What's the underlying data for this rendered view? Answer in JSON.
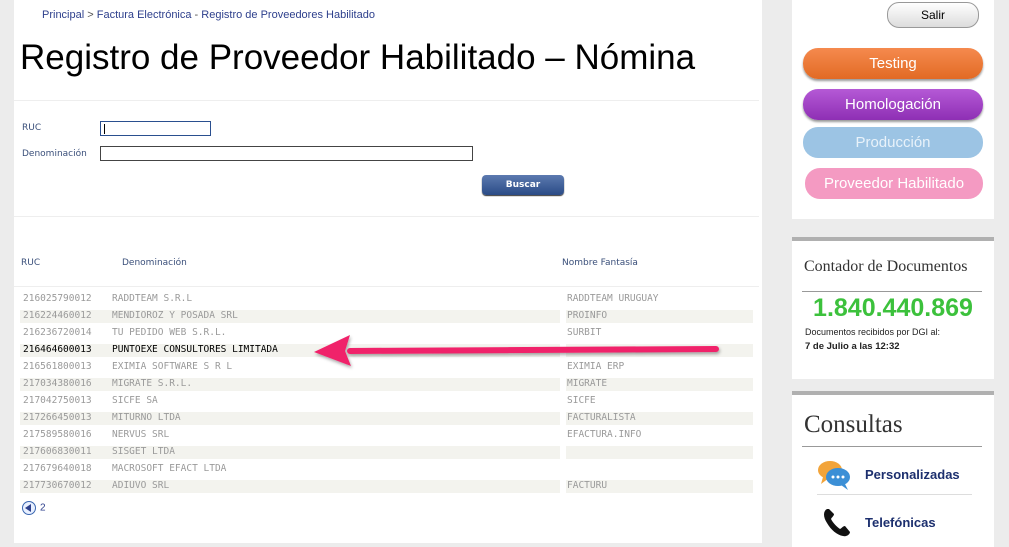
{
  "breadcrumb": {
    "items": [
      "Principal",
      "Factura Electrónica",
      "Registro de Proveedores Habilitado"
    ],
    "separator": " > ",
    "separator2": " - "
  },
  "page_title": "Registro de Proveedor Habilitado – Nómina",
  "search": {
    "ruc_label": "RUC",
    "ruc_value": "",
    "denominacion_label": "Denominación",
    "denominacion_value": "",
    "button_label": "Buscar"
  },
  "table": {
    "headers": [
      "RUC",
      "Denominación",
      "Nombre Fantasía"
    ],
    "rows": [
      {
        "ruc": "216025790012",
        "denominacion": "RADDTEAM S.R.L",
        "fantasia": "RADDTEAM URUGUAY"
      },
      {
        "ruc": "216224460012",
        "denominacion": "MENDIOROZ Y POSADA SRL",
        "fantasia": "PROINFO"
      },
      {
        "ruc": "216236720014",
        "denominacion": "TU PEDIDO WEB S.R.L.",
        "fantasia": "SURBIT"
      },
      {
        "ruc": "216464600013",
        "denominacion": "PUNTOEXE CONSULTORES LIMITADA",
        "fantasia": ""
      },
      {
        "ruc": "216561800013",
        "denominacion": "EXIMIA SOFTWARE S R L",
        "fantasia": "EXIMIA ERP"
      },
      {
        "ruc": "217034380016",
        "denominacion": "MIGRATE S.R.L.",
        "fantasia": "MIGRATE"
      },
      {
        "ruc": "217042750013",
        "denominacion": "SICFE SA",
        "fantasia": "SICFE"
      },
      {
        "ruc": "217266450013",
        "denominacion": "MITURNO LTDA",
        "fantasia": "FACTURALISTA"
      },
      {
        "ruc": "217589580016",
        "denominacion": "NERVUS SRL",
        "fantasia": "EFACTURA.INFO"
      },
      {
        "ruc": "217606830011",
        "denominacion": "SISGET LTDA",
        "fantasia": ""
      },
      {
        "ruc": "217679640018",
        "denominacion": "MACROSOFT EFACT LTDA",
        "fantasia": ""
      },
      {
        "ruc": "217730670012",
        "denominacion": "ADIUVO SRL",
        "fantasia": "FACTURU"
      }
    ],
    "highlighted_row": 3
  },
  "pager": {
    "page": "2"
  },
  "sidebar": {
    "salir_label": "Salir",
    "env_buttons": [
      "Testing",
      "Homologación",
      "Producción",
      "Proveedor Habilitado"
    ],
    "counter_title": "Contador de Documentos",
    "counter_value": "1.840.440.869",
    "counter_sub": "Documentos recibidos por DGI al:",
    "counter_date": "7 de Julio a las 12:32",
    "consultas_title": "Consultas",
    "consultas_items": [
      {
        "label": "Personalizadas",
        "icon": "chat-bubbles-icon"
      },
      {
        "label": "Telefónicas",
        "icon": "phone-icon"
      }
    ]
  },
  "colors": {
    "accent": "#2d3f8c",
    "counter": "#3cc13c",
    "arrow": "#f0246a"
  }
}
